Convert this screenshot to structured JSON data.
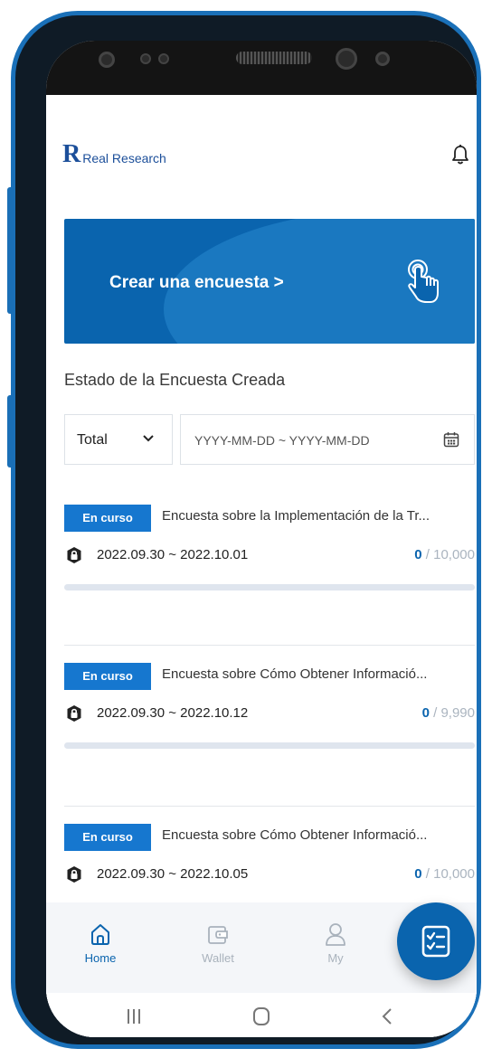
{
  "header": {
    "logo_mark": "R",
    "logo_text": "Real Research"
  },
  "banner": {
    "title": "Crear una encuesta >"
  },
  "status_section": {
    "title": "Estado de la Encuesta Creada"
  },
  "filters": {
    "status_select": "Total",
    "date_range_placeholder": "YYYY-MM-DD ~ YYYY-MM-DD"
  },
  "surveys": [
    {
      "status": "En curso",
      "title": "Encuesta sobre la Implementación de la Tr...",
      "dates": "2022.09.30 ~ 2022.10.01",
      "current": "0",
      "total": "/ 10,000",
      "progress": 0
    },
    {
      "status": "En curso",
      "title": "Encuesta sobre Cómo Obtener Informació...",
      "dates": "2022.09.30 ~ 2022.10.12",
      "current": "0",
      "total": "/ 9,990",
      "progress": 0
    },
    {
      "status": "En curso",
      "title": "Encuesta sobre Cómo Obtener Informació...",
      "dates": "2022.09.30 ~ 2022.10.05",
      "current": "0",
      "total": "/ 10,000",
      "progress": 0
    }
  ],
  "bottom_nav": {
    "items": [
      {
        "label": "Home",
        "icon": "home-icon",
        "active": true
      },
      {
        "label": "Wallet",
        "icon": "wallet-icon",
        "active": false
      },
      {
        "label": "My",
        "icon": "user-icon",
        "active": false
      }
    ],
    "fab_icon": "survey-checklist-icon"
  },
  "system_nav": {
    "recents_icon": "recents-icon",
    "home_icon": "home-circle-icon",
    "back_icon": "back-icon"
  },
  "colors": {
    "primary": "#0a64ae",
    "badge": "#1677cf",
    "phone_frame": "#1a70b8",
    "inactive": "#a9b2bc"
  }
}
